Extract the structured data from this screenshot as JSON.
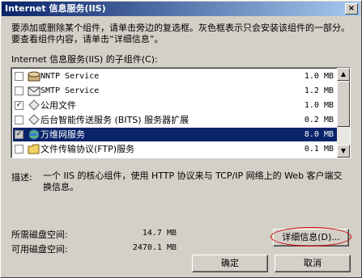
{
  "window": {
    "title": "Internet 信息服务(IIS)",
    "close_label": "×"
  },
  "instructions": "要添加或删除某个组件，请单击旁边的复选框。灰色框表示只会安装该组件的一部分。要查看组件内容，请单击“详细信息”。",
  "list_label": "Internet 信息服务(IIS) 的子组件(C):",
  "components": [
    {
      "name": "NNTP Service",
      "size": "1.0 MB",
      "checked": false,
      "partial": false,
      "selected": false,
      "icon": "nntp-icon"
    },
    {
      "name": "SMTP Service",
      "size": "1.2 MB",
      "checked": false,
      "partial": false,
      "selected": false,
      "icon": "smtp-icon"
    },
    {
      "name": "公用文件",
      "size": "1.0 MB",
      "checked": true,
      "partial": false,
      "selected": false,
      "icon": "common-files-icon"
    },
    {
      "name": "后台智能传送服务 (BITS) 服务器扩展",
      "size": "0.2 MB",
      "checked": false,
      "partial": false,
      "selected": false,
      "icon": "bits-icon"
    },
    {
      "name": "万维网服务",
      "size": "8.0 MB",
      "checked": true,
      "partial": true,
      "selected": true,
      "icon": "www-icon"
    },
    {
      "name": "文件传输协议(FTP)服务",
      "size": "0.1 MB",
      "checked": false,
      "partial": false,
      "selected": false,
      "icon": "ftp-folder-icon"
    }
  ],
  "description": {
    "label": "描述:",
    "text": "一个 IIS 的核心组件，使用 HTTP 协议来与 TCP/IP 网络上的 Web 客户端交换信息。"
  },
  "disk": {
    "required_label": "所需磁盘空间:",
    "required_value": "14.7 MB",
    "available_label": "可用磁盘空间:",
    "available_value": "2470.1 MB"
  },
  "buttons": {
    "details": "详细信息(D)...",
    "ok": "确定",
    "cancel": "取消"
  },
  "colors": {
    "selection": "#0a246a",
    "annotation_circle": "#d00000"
  }
}
